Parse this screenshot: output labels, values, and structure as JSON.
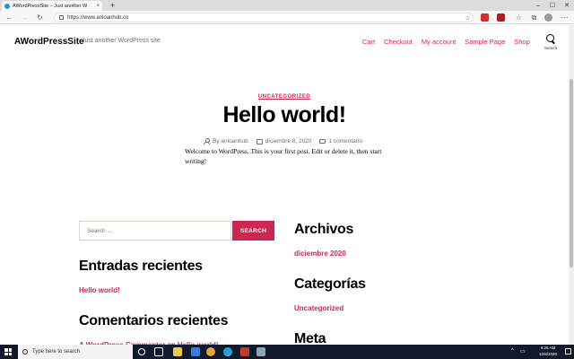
{
  "browser": {
    "tab_title": "AWordPressSite – Just another W",
    "tab_close": "×",
    "new_tab": "+",
    "url": "https://www.anloanhub.co",
    "window_controls": [
      "–",
      "☐",
      "✕"
    ],
    "nav_icons": [
      "back-arrow-icon",
      "forward-arrow-icon",
      "refresh-icon"
    ]
  },
  "site": {
    "title": "AWordPressSite",
    "description": "Just another WordPress site",
    "menu": [
      "Cart",
      "Checkout",
      "My account",
      "Sample Page",
      "Shop"
    ],
    "search_label": "Search"
  },
  "post": {
    "category": "UNCATEGORIZED",
    "title": "Hello world!",
    "author": "By anloanhub",
    "date": "diciembre 8, 2020",
    "comments": "1 comentario",
    "body": "Welcome to WordPress. This is your first post. Edit or delete it, then start writing!"
  },
  "widgets": {
    "search_placeholder": "Search …",
    "search_button": "SEARCH",
    "recent_posts_title": "Entradas recientes",
    "recent_post_1": "Hello world!",
    "recent_comments_title": "Comentarios recientes",
    "recent_comment_author": "A WordPress Commenter",
    "recent_comment_on": " en ",
    "recent_comment_post": "Hello world!",
    "archives_title": "Archivos",
    "archive_1": "diciembre 2020",
    "categories_title": "Categorías",
    "category_1": "Uncategorized",
    "meta_title": "Meta"
  },
  "taskbar": {
    "search_placeholder": "Type here to search",
    "time": "9:26 AM",
    "date": "12/8/2020",
    "tray_chevron": "^"
  },
  "colors": {
    "accent": "#cd2653",
    "taskbar": "#101a2c"
  }
}
